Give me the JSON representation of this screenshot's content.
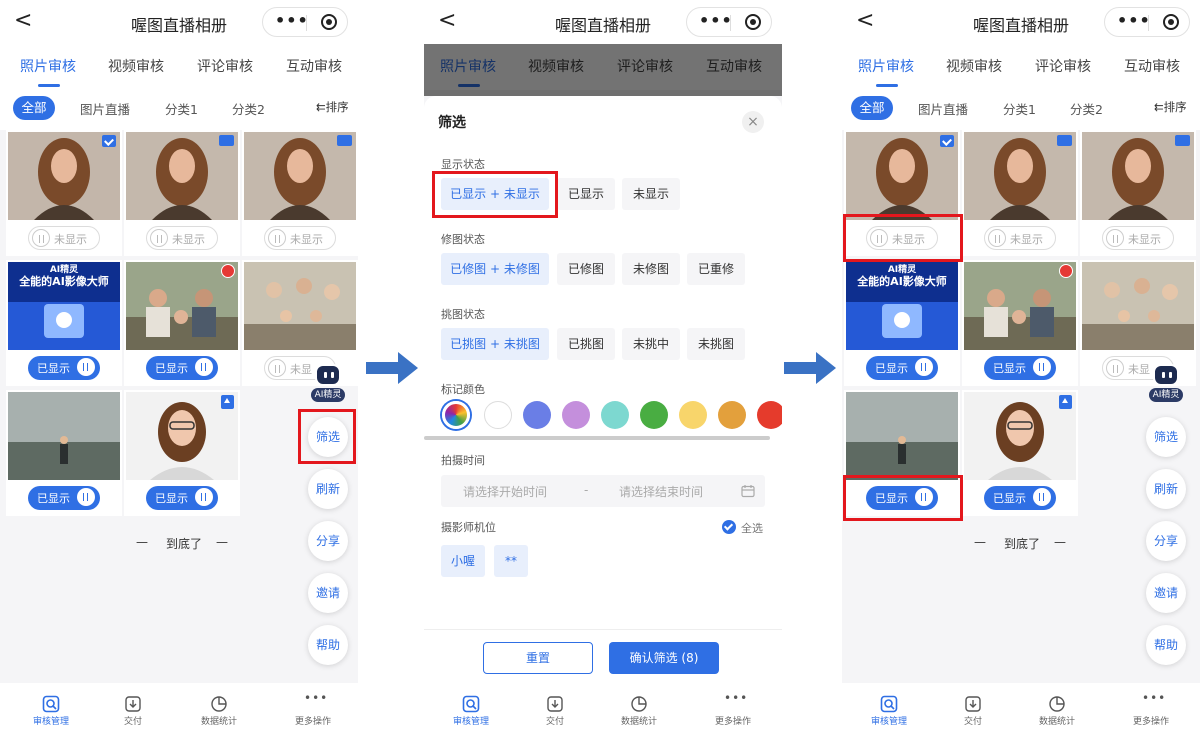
{
  "app": {
    "title": "喔图直播相册",
    "back": "<",
    "capsule_dots": "•••"
  },
  "tabs": [
    "照片审核",
    "视频审核",
    "评论审核",
    "互动审核"
  ],
  "categories": {
    "all": "全部",
    "items": [
      "图片直播",
      "分类1",
      "分类2"
    ],
    "sort": "排序"
  },
  "photos": [
    {
      "status": "未显示",
      "badge": "check"
    },
    {
      "status": "未显示",
      "badge": "camera"
    },
    {
      "status": "未显示",
      "badge": "camera"
    },
    {
      "status": "已显示",
      "badge": "none",
      "caption1": "AI精灵",
      "caption2": "全能的AI影像大师"
    },
    {
      "status": "已显示",
      "badge": "red-dot"
    },
    {
      "status": "未显示",
      "badge": "none"
    },
    {
      "status": "已显示",
      "badge": "none"
    },
    {
      "status": "已显示",
      "badge": "upload"
    }
  ],
  "status_truncated": "未显",
  "list_end": {
    "left_dash": "—",
    "text": "到底了",
    "right_dash": "—"
  },
  "ai_assistant": {
    "label": "AI精灵"
  },
  "fabs": [
    "筛选",
    "刷新",
    "分享",
    "邀请",
    "帮助"
  ],
  "bottom_nav": [
    "审核管理",
    "交付",
    "数据统计",
    "更多操作"
  ],
  "filter": {
    "title": "筛选",
    "close": "×",
    "display_status": {
      "label": "显示状态",
      "options": [
        "已显示 + 未显示",
        "已显示",
        "未显示"
      ]
    },
    "retouch_status": {
      "label": "修图状态",
      "options": [
        "已修图 + 未修图",
        "已修图",
        "未修图",
        "已重修"
      ]
    },
    "pick_status": {
      "label": "挑图状态",
      "options": [
        "已挑图 + 未挑图",
        "已挑图",
        "未挑中",
        "未挑图"
      ]
    },
    "mark_color": {
      "label": "标记颜色",
      "colors": [
        "rainbow",
        "#ffffff",
        "#6a7ee6",
        "#c48fdc",
        "#7dd8d0",
        "#49ad42",
        "#f8d56b",
        "#e3a03c",
        "#e53b2c"
      ]
    },
    "shoot_time": {
      "label": "拍摄时间",
      "start_placeholder": "请选择开始时间",
      "separator": "-",
      "end_placeholder": "请选择结束时间"
    },
    "photographer": {
      "label": "摄影师机位",
      "select_all": "全选",
      "options": [
        "小喔",
        "**"
      ]
    },
    "reset": "重置",
    "confirm": "确认筛选 (8)"
  },
  "colors": {
    "accent": "#2f6fe4",
    "highlight": "#e3171d",
    "arrow": "#3a72c4"
  }
}
